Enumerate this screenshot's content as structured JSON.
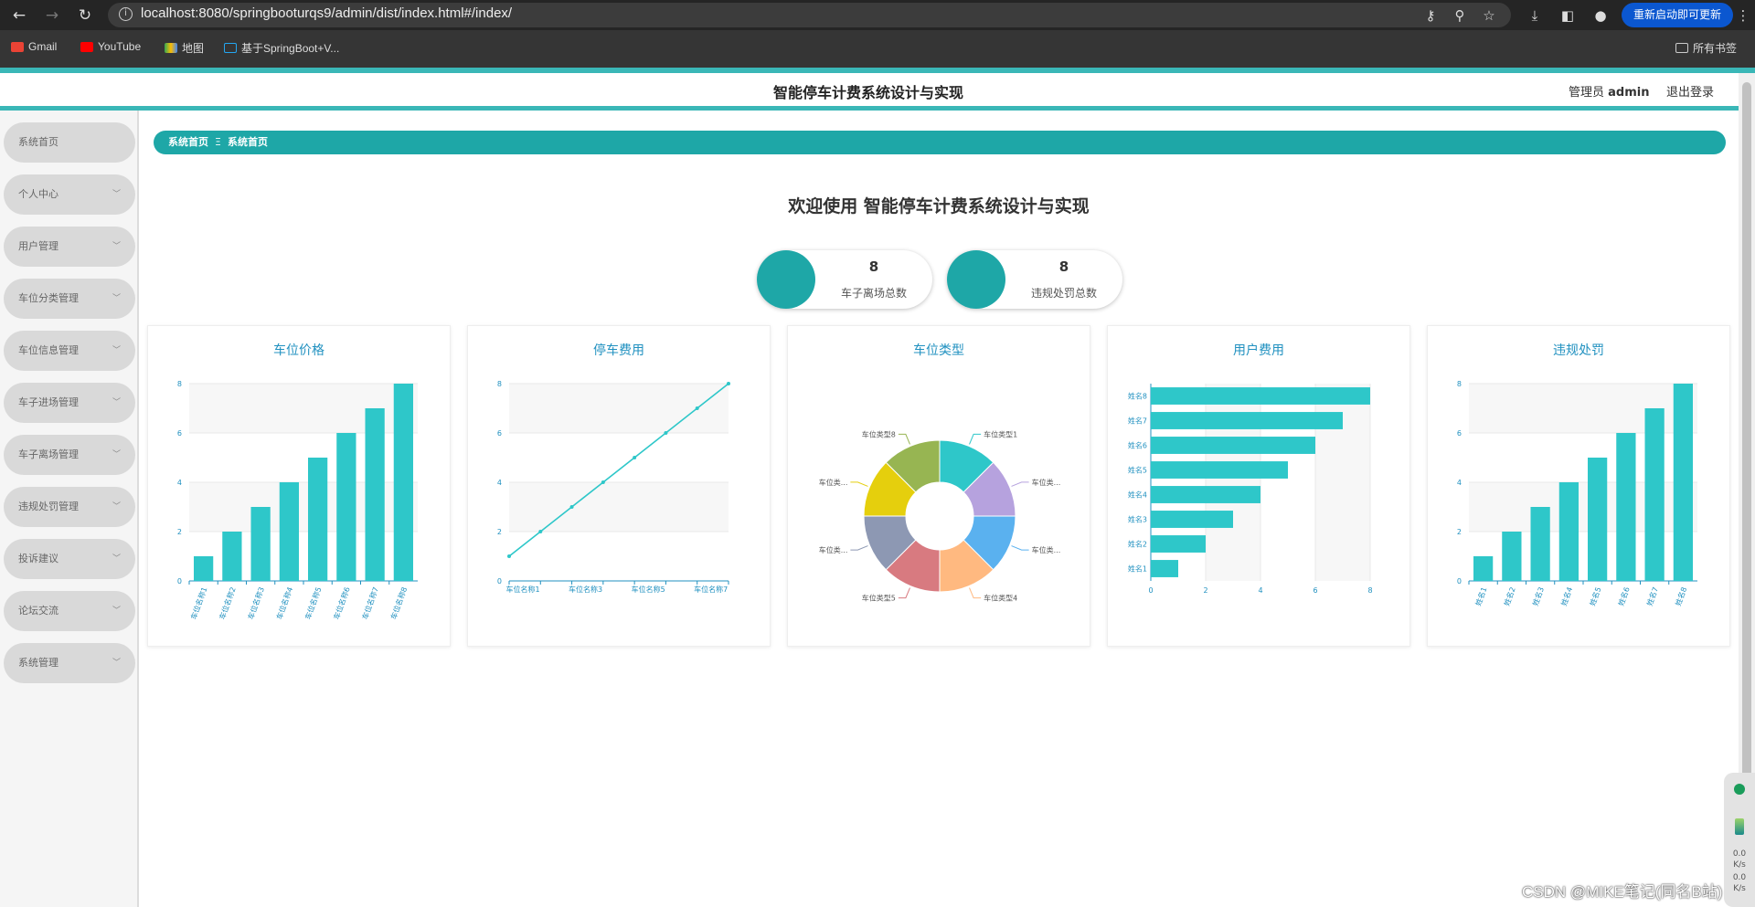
{
  "browser": {
    "url": "localhost:8080/springbooturqs9/admin/dist/index.html#/index/",
    "update_button": "重新启动即可更新",
    "bookmarks": [
      "Gmail",
      "YouTube",
      "地图",
      "基于SpringBoot+V..."
    ],
    "all_bookmarks": "所有书签"
  },
  "header": {
    "title": "智能停车计费系统设计与实现",
    "role": "管理员",
    "username": "admin",
    "logout": "退出登录"
  },
  "sidebar": {
    "items": [
      {
        "label": "系统首页",
        "has_submenu": false
      },
      {
        "label": "个人中心",
        "has_submenu": true
      },
      {
        "label": "用户管理",
        "has_submenu": true
      },
      {
        "label": "车位分类管理",
        "has_submenu": true
      },
      {
        "label": "车位信息管理",
        "has_submenu": true
      },
      {
        "label": "车子进场管理",
        "has_submenu": true
      },
      {
        "label": "车子离场管理",
        "has_submenu": true
      },
      {
        "label": "违规处罚管理",
        "has_submenu": true
      },
      {
        "label": "投诉建议",
        "has_submenu": true
      },
      {
        "label": "论坛交流",
        "has_submenu": true
      },
      {
        "label": "系统管理",
        "has_submenu": true
      }
    ]
  },
  "breadcrumb": {
    "home": "系统首页",
    "separator": "Ξ",
    "current": "系统首页"
  },
  "welcome": "欢迎使用 智能停车计费系统设计与实现",
  "stats": [
    {
      "value": "8",
      "label": "车子离场总数"
    },
    {
      "value": "8",
      "label": "违规处罚总数"
    }
  ],
  "colors": {
    "accent": "#1ea7a7",
    "bar": "#2ec7c9",
    "title_blue": "#2191c0"
  },
  "chart_data": [
    {
      "type": "bar",
      "title": "车位价格",
      "categories": [
        "车位名称1",
        "车位名称2",
        "车位名称3",
        "车位名称4",
        "车位名称5",
        "车位名称6",
        "车位名称7",
        "车位名称8"
      ],
      "values": [
        1,
        2,
        3,
        4,
        5,
        6,
        7,
        8
      ],
      "yticks": [
        "0",
        "2",
        "4",
        "6",
        "8"
      ],
      "ylim": [
        0,
        8
      ]
    },
    {
      "type": "line",
      "title": "停车费用",
      "categories": [
        "车位名称1",
        "车位名称2",
        "车位名称3",
        "车位名称4",
        "车位名称5",
        "车位名称6",
        "车位名称7",
        "车位名称8"
      ],
      "values": [
        1,
        2,
        3,
        4,
        5,
        6,
        7,
        8
      ],
      "visible_xlabels": [
        "车位名称1",
        "车位名称3",
        "车位名称5",
        "车位名称7"
      ],
      "yticks": [
        "0",
        "2",
        "4",
        "6",
        "8"
      ],
      "ylim": [
        0,
        8
      ]
    },
    {
      "type": "pie",
      "title": "车位类型",
      "donut": true,
      "slices": [
        {
          "label": "车位类型1",
          "value": 1,
          "color": "#2ec7c9"
        },
        {
          "label": "车位类...",
          "value": 1,
          "color": "#b6a2de"
        },
        {
          "label": "车位类...",
          "value": 1,
          "color": "#5ab1ef"
        },
        {
          "label": "车位类型4",
          "value": 1,
          "color": "#ffb980"
        },
        {
          "label": "车位类型5",
          "value": 1,
          "color": "#d87a80"
        },
        {
          "label": "车位类...",
          "value": 1,
          "color": "#8d98b3"
        },
        {
          "label": "车位类...",
          "value": 1,
          "color": "#e5cf0d"
        },
        {
          "label": "车位类型8",
          "value": 1,
          "color": "#97b552"
        }
      ]
    },
    {
      "type": "bar",
      "orientation": "horizontal",
      "title": "用户费用",
      "categories": [
        "姓名1",
        "姓名2",
        "姓名3",
        "姓名4",
        "姓名5",
        "姓名6",
        "姓名7",
        "姓名8"
      ],
      "values": [
        1,
        2,
        3,
        4,
        5,
        6,
        7,
        8
      ],
      "xticks": [
        "0",
        "2",
        "4",
        "6",
        "8"
      ],
      "xlim": [
        0,
        8
      ]
    },
    {
      "type": "bar",
      "title": "违规处罚",
      "categories": [
        "姓名1",
        "姓名2",
        "姓名3",
        "姓名4",
        "姓名5",
        "姓名6",
        "姓名7",
        "姓名8"
      ],
      "values": [
        1,
        2,
        3,
        4,
        5,
        6,
        7,
        8
      ],
      "yticks": [
        "0",
        "2",
        "4",
        "6",
        "8"
      ],
      "ylim": [
        0,
        8
      ]
    }
  ],
  "tray": {
    "line1": "0.0",
    "line2": "K/s",
    "line3": "0.0",
    "line4": "K/s"
  },
  "watermark": "CSDN @MIKE笔记(同名B站)"
}
